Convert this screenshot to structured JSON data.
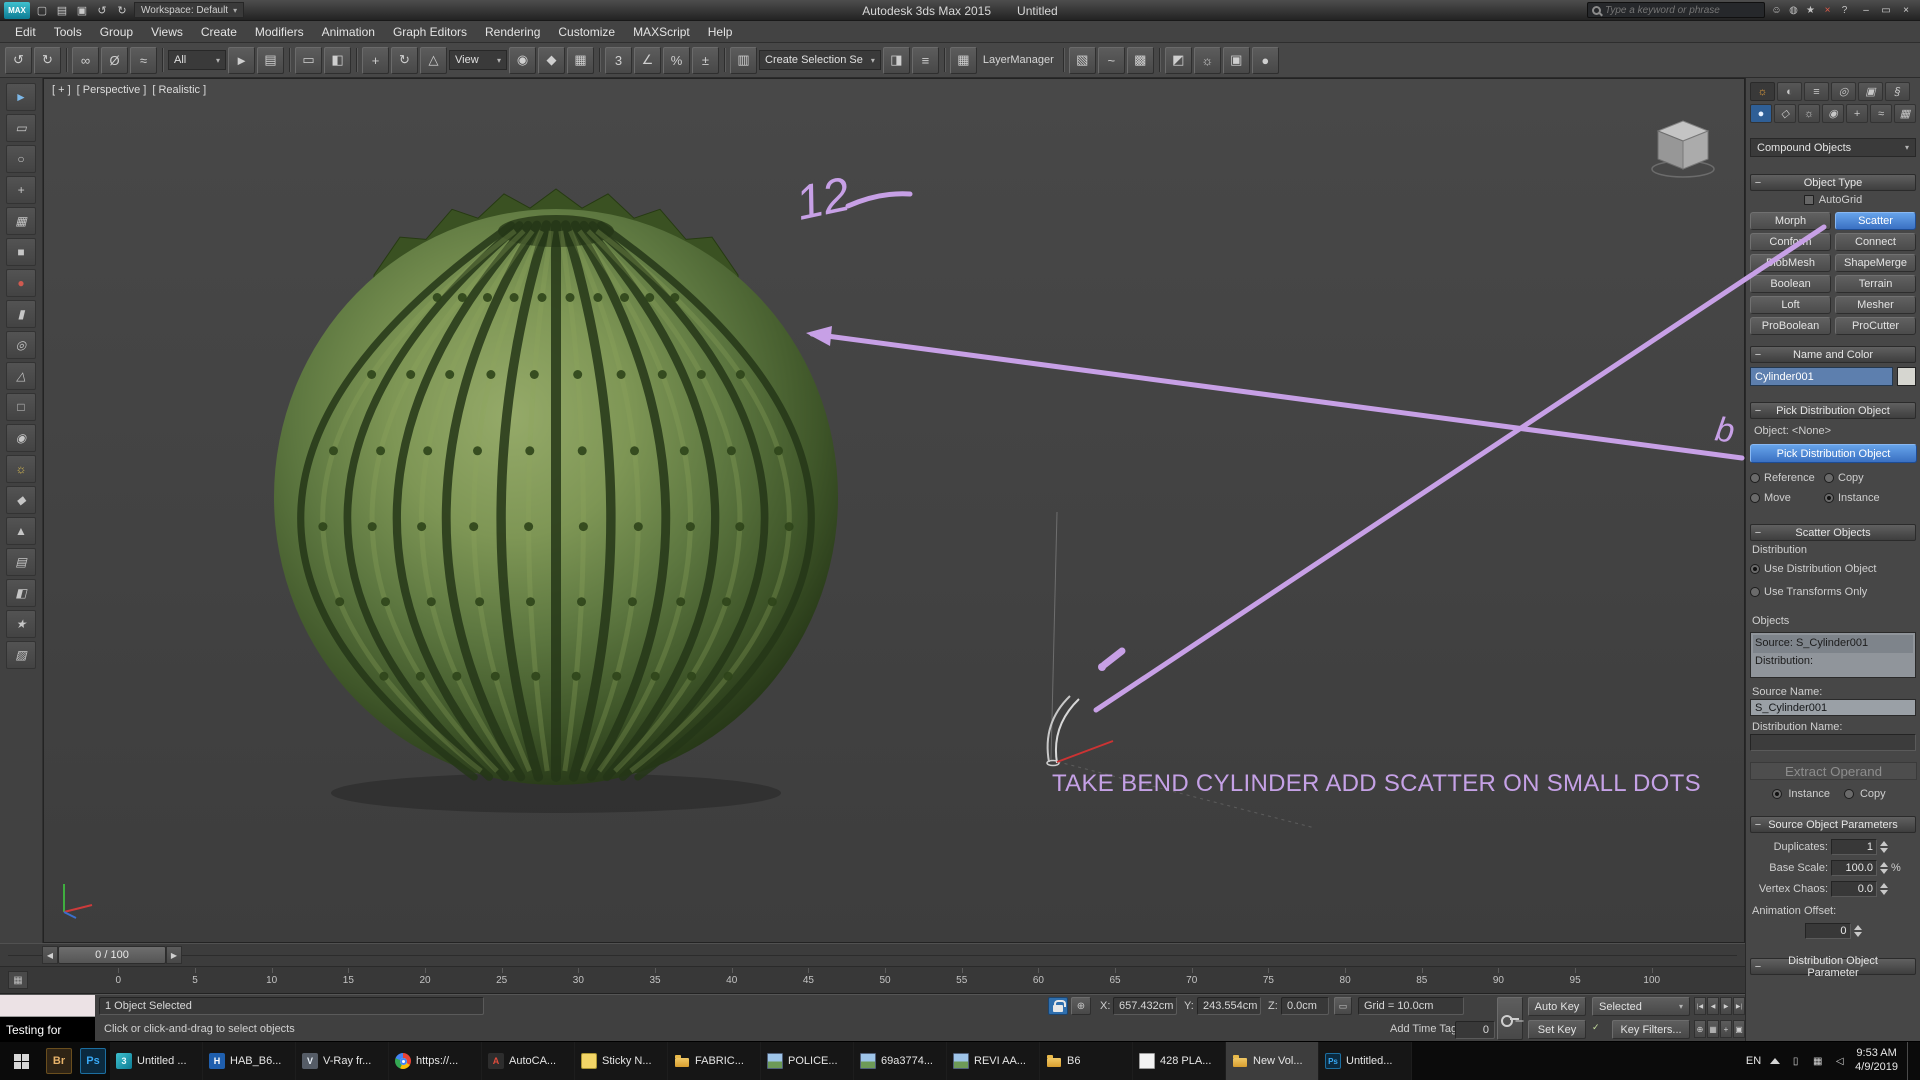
{
  "colors": {
    "annotation_purple": "#c7a0e6",
    "selection_blue": "#3d7cd0",
    "viewport_bg": "#424242"
  },
  "titlebar": {
    "logo_text": "MAX",
    "app_title": "Autodesk 3ds Max 2015",
    "doc_title": "Untitled",
    "workspace_label": "Workspace: Default",
    "search_placeholder": "Type a keyword or phrase",
    "qa_icons": [
      {
        "name": "new-scene-icon",
        "glyph": "▢"
      },
      {
        "name": "open-file-icon",
        "glyph": "▤"
      },
      {
        "name": "save-file-icon",
        "glyph": "▣"
      },
      {
        "name": "undo-icon",
        "glyph": "↺"
      },
      {
        "name": "redo-icon",
        "glyph": "↻"
      }
    ],
    "info_icons": [
      {
        "name": "sign-in-icon",
        "glyph": "☺"
      },
      {
        "name": "communication-center-icon",
        "glyph": "◍"
      },
      {
        "name": "favorites-icon",
        "glyph": "★"
      },
      {
        "name": "close-search-icon",
        "glyph": "×",
        "tone": "red"
      },
      {
        "name": "help-icon",
        "glyph": "?"
      }
    ],
    "window_icons": [
      {
        "name": "minimize-icon",
        "glyph": "–"
      },
      {
        "name": "restore-icon",
        "glyph": "▭"
      },
      {
        "name": "close-icon",
        "glyph": "×"
      }
    ]
  },
  "menubar": {
    "items": [
      "Edit",
      "Tools",
      "Group",
      "Views",
      "Create",
      "Modifiers",
      "Animation",
      "Graph Editors",
      "Rendering",
      "Customize",
      "MAXScript",
      "Help"
    ]
  },
  "toolbar": {
    "items": [
      {
        "type": "icon",
        "name": "undo-icon",
        "glyph": "↺",
        "act": "true"
      },
      {
        "type": "icon",
        "name": "redo-icon",
        "glyph": "↻",
        "act": "true"
      },
      {
        "type": "sep",
        "name": "toolbar-separator",
        "act": "false"
      },
      {
        "type": "icon",
        "name": "select-and-link-icon",
        "glyph": "∞",
        "act": "true"
      },
      {
        "type": "icon",
        "name": "unlink-selection-icon",
        "glyph": "Ø",
        "act": "true"
      },
      {
        "type": "icon",
        "name": "bind-to-space-warp-icon",
        "glyph": "≈",
        "act": "true"
      },
      {
        "type": "sep",
        "name": "toolbar-separator",
        "act": "false"
      },
      {
        "type": "drop",
        "name": "selection-filter-dropdown",
        "label": "All",
        "act": "true"
      },
      {
        "type": "icon",
        "name": "select-object-icon",
        "glyph": "►",
        "act": "true"
      },
      {
        "type": "icon",
        "name": "select-by-name-icon",
        "glyph": "▤",
        "act": "true"
      },
      {
        "type": "sep",
        "name": "toolbar-separator",
        "act": "false"
      },
      {
        "type": "icon",
        "name": "rectangular-selection-icon",
        "glyph": "▭",
        "act": "true"
      },
      {
        "type": "icon",
        "name": "window-crossing-icon",
        "glyph": "◧",
        "act": "true"
      },
      {
        "type": "sep",
        "name": "toolbar-separator",
        "act": "false"
      },
      {
        "type": "icon",
        "name": "select-and-move-icon",
        "glyph": "+",
        "act": "true"
      },
      {
        "type": "icon",
        "name": "select-and-rotate-icon",
        "glyph": "↻",
        "act": "true"
      },
      {
        "type": "icon",
        "name": "select-and-scale-icon",
        "glyph": "△",
        "act": "true"
      },
      {
        "type": "drop",
        "name": "reference-coordinate-dropdown",
        "label": "View",
        "act": "true"
      },
      {
        "type": "icon",
        "name": "use-pivot-center-icon",
        "glyph": "◉",
        "act": "true"
      },
      {
        "type": "icon",
        "name": "select-and-manipulate-icon",
        "glyph": "◆",
        "act": "true"
      },
      {
        "type": "icon",
        "name": "keyboard-override-icon",
        "glyph": "▦",
        "act": "true"
      },
      {
        "type": "sep",
        "name": "toolbar-separator",
        "act": "false"
      },
      {
        "type": "icon",
        "name": "snap-toggle-3d-icon",
        "glyph": "3",
        "act": "true"
      },
      {
        "type": "icon",
        "name": "angle-snap-icon",
        "glyph": "∠",
        "act": "true"
      },
      {
        "type": "icon",
        "name": "percent-snap-icon",
        "glyph": "%",
        "act": "true"
      },
      {
        "type": "icon",
        "name": "spinner-snap-icon",
        "glyph": "±",
        "act": "true"
      },
      {
        "type": "sep",
        "name": "toolbar-separator",
        "act": "false"
      },
      {
        "type": "icon",
        "name": "named-selection-sets-icon",
        "glyph": "▥",
        "act": "true"
      },
      {
        "type": "drop",
        "name": "named-selection-dropdown",
        "label": "Create Selection Se",
        "act": "true"
      },
      {
        "type": "icon",
        "name": "mirror-icon",
        "glyph": "◨",
        "act": "true"
      },
      {
        "type": "icon",
        "name": "align-icon",
        "glyph": "≡",
        "act": "true"
      },
      {
        "type": "sep",
        "name": "toolbar-separator",
        "act": "false"
      },
      {
        "type": "icon",
        "name": "layer-manager-icon",
        "glyph": "▦",
        "act": "true"
      },
      {
        "type": "label",
        "name": "layer-manager-label",
        "label": "LayerManager",
        "act": "false"
      },
      {
        "type": "sep",
        "name": "toolbar-separator",
        "act": "false"
      },
      {
        "type": "icon",
        "name": "graphite-ribbon-icon",
        "glyph": "▧",
        "act": "true"
      },
      {
        "type": "icon",
        "name": "curve-editor-icon",
        "glyph": "~",
        "act": "true"
      },
      {
        "type": "icon",
        "name": "schematic-view-icon",
        "glyph": "▩",
        "act": "true"
      },
      {
        "type": "sep",
        "name": "toolbar-separator",
        "act": "false"
      },
      {
        "type": "icon",
        "name": "material-editor-icon",
        "glyph": "◩",
        "act": "true"
      },
      {
        "type": "icon",
        "name": "render-setup-icon",
        "glyph": "☼",
        "act": "true"
      },
      {
        "type": "icon",
        "name": "rendered-frame-icon",
        "glyph": "▣",
        "act": "true"
      },
      {
        "type": "icon",
        "name": "render-production-icon",
        "glyph": "●",
        "act": "true"
      }
    ]
  },
  "left_strip": {
    "icons": [
      {
        "name": "select-cursor-icon",
        "glyph": "►",
        "tone": "blue"
      },
      {
        "name": "marquee-select-icon",
        "glyph": "▭"
      },
      {
        "name": "circle-select-icon",
        "glyph": "○"
      },
      {
        "name": "paint-select-icon",
        "glyph": "+"
      },
      {
        "name": "grid-helper-icon",
        "glyph": "▦"
      },
      {
        "name": "box-primitive-icon",
        "glyph": "■"
      },
      {
        "name": "sphere-primitive-icon",
        "glyph": "●",
        "tone": "red"
      },
      {
        "name": "cylinder-primitive-icon",
        "glyph": "▮"
      },
      {
        "name": "torus-primitive-icon",
        "glyph": "◎"
      },
      {
        "name": "cone-primitive-icon",
        "glyph": "△"
      },
      {
        "name": "plane-primitive-icon",
        "glyph": "□"
      },
      {
        "name": "geosphere-primitive-icon",
        "glyph": "◉"
      },
      {
        "name": "light-icon",
        "glyph": "☼",
        "tone": "yellow"
      },
      {
        "name": "gem-icon",
        "glyph": "◆"
      },
      {
        "name": "pyramid-primitive-icon",
        "glyph": "▲"
      },
      {
        "name": "list-view-icon",
        "glyph": "▤"
      },
      {
        "name": "half-shade-icon",
        "glyph": "◧"
      },
      {
        "name": "star-shape-icon",
        "glyph": "★"
      },
      {
        "name": "hatch-icon",
        "glyph": "▨"
      }
    ]
  },
  "viewport": {
    "label_plus": "[ + ]",
    "label_view": "[ Perspective ]",
    "label_shading": "[ Realistic ]",
    "annotation_text": "TAKE BEND CYLINDER ADD SCATTER ON SMALL DOTS",
    "scribble_12": "12",
    "scribble_b": "b"
  },
  "command_panel": {
    "tabs": [
      {
        "name": "create-tab-icon",
        "glyph": "☼",
        "state": "active orange"
      },
      {
        "name": "modify-tab-icon",
        "glyph": "◐"
      },
      {
        "name": "hierarchy-tab-icon",
        "glyph": "≡"
      },
      {
        "name": "motion-tab-icon",
        "glyph": "◎"
      },
      {
        "name": "display-tab-icon",
        "glyph": "▣"
      },
      {
        "name": "utilities-tab-icon",
        "glyph": "§"
      }
    ],
    "categories": [
      {
        "name": "geometry-category-icon",
        "glyph": "●",
        "state": "blue"
      },
      {
        "name": "shapes-category-icon",
        "glyph": "◇"
      },
      {
        "name": "lights-category-icon",
        "glyph": "☼"
      },
      {
        "name": "cameras-category-icon",
        "glyph": "◉"
      },
      {
        "name": "helpers-category-icon",
        "glyph": "+"
      },
      {
        "name": "space-warps-category-icon",
        "glyph": "≈"
      },
      {
        "name": "systems-category-icon",
        "glyph": "▦"
      }
    ],
    "category_dropdown": "Compound Objects",
    "object_type": {
      "title": "Object Type",
      "autogrid_label": "AutoGrid",
      "buttons": [
        {
          "label": "Morph"
        },
        {
          "label": "Scatter",
          "state": "active"
        },
        {
          "label": "Conform"
        },
        {
          "label": "Connect"
        },
        {
          "label": "BlobMesh"
        },
        {
          "label": "ShapeMerge"
        },
        {
          "label": "Boolean"
        },
        {
          "label": "Terrain"
        },
        {
          "label": "Loft"
        },
        {
          "label": "Mesher"
        },
        {
          "label": "ProBoolean"
        },
        {
          "label": "ProCutter"
        }
      ]
    },
    "name_color": {
      "title": "Name and Color",
      "object_name": "Cylinder001"
    },
    "pick_distribution": {
      "title": "Pick Distribution Object",
      "object_label": "Object: <None>",
      "button_label": "Pick Distribution Object",
      "reference": "Reference",
      "copy": "Copy",
      "move": "Move",
      "instance": "Instance"
    },
    "scatter_objects": {
      "title": "Scatter Objects",
      "dist_label": "Distribution",
      "use_dist": "Use Distribution Object",
      "use_transforms": "Use Transforms Only",
      "objects_label": "Objects",
      "list_line1": "Source: S_Cylinder001",
      "list_line2": "Distribution:",
      "source_name_label": "Source Name:",
      "source_name_value": "S_Cylinder001",
      "dist_name_label": "Distribution Name:",
      "dist_name_value": "",
      "extract_label": "Extract Operand",
      "instance": "Instance",
      "copy": "Copy"
    },
    "source_params": {
      "title": "Source Object Parameters",
      "duplicates_label": "Duplicates:",
      "duplicates_value": "1",
      "base_scale_label": "Base Scale:",
      "base_scale_value": "100.0",
      "percent_label": "%",
      "vertex_chaos_label": "Vertex Chaos:",
      "vertex_chaos_value": "0.0",
      "anim_offset_label": "Animation Offset:",
      "anim_offset_value": "0"
    },
    "dist_params_title": "Distribution Object Parameter"
  },
  "timeline": {
    "slider_label": "0 / 100",
    "prev_glyph": "◀",
    "next_glyph": "▶",
    "ticks": [
      "0",
      "5",
      "10",
      "15",
      "20",
      "25",
      "30",
      "35",
      "40",
      "45",
      "50",
      "55",
      "60",
      "65",
      "70",
      "75",
      "80",
      "85",
      "90",
      "95",
      "100"
    ]
  },
  "statusbar": {
    "listener_text": "Testing for",
    "selected": "1 Object Selected",
    "prompt": "Click or click-and-drag to select objects",
    "x_label": "X:",
    "x_value": "657.432cm",
    "y_label": "Y:",
    "y_value": "243.554cm",
    "z_label": "Z:",
    "z_value": "0.0cm",
    "grid_label": "Grid = 10.0cm",
    "add_time_tag": "Add Time Tag",
    "frame_value": "0",
    "auto_key": "Auto Key",
    "set_key": "Set Key",
    "selected_dropdown": "Selected",
    "key_filters": "Key Filters...",
    "check_glyph": "✓",
    "aux_glyph": "⊕",
    "abs_glyph": "▭",
    "playback": [
      {
        "name": "go-to-start-icon",
        "glyph": "|◀"
      },
      {
        "name": "previous-frame-icon",
        "glyph": "◀"
      },
      {
        "name": "play-icon",
        "glyph": "▶"
      },
      {
        "name": "go-to-end-icon",
        "glyph": "▶|"
      }
    ],
    "nav": [
      {
        "name": "zoom-icon",
        "glyph": "⊕"
      },
      {
        "name": "zoom-extents-icon",
        "glyph": "▦"
      },
      {
        "name": "pan-icon",
        "glyph": "+"
      },
      {
        "name": "maximize-viewport-icon",
        "glyph": "▣"
      }
    ]
  },
  "taskbar": {
    "pins": [
      {
        "icon": "bridge",
        "glyph": "Br",
        "name": "bridge-icon"
      },
      {
        "icon": "photoshop",
        "glyph": "Ps",
        "name": "photoshop-icon"
      }
    ],
    "items": [
      {
        "label": "Untitled ...",
        "icon": "max",
        "name": "3dsmax-task",
        "glyph": "3"
      },
      {
        "label": "HAB_B6...",
        "icon": "hab",
        "name": "hab-file-task",
        "glyph": "H"
      },
      {
        "label": "V-Ray fr...",
        "icon": "vray",
        "name": "vray-task",
        "glyph": "V"
      },
      {
        "label": "https://...",
        "icon": "chrome",
        "name": "chrome-task",
        "glyph": ""
      },
      {
        "label": "AutoCA...",
        "icon": "acad",
        "name": "autocad-task",
        "glyph": "A"
      },
      {
        "label": "Sticky N...",
        "icon": "sticky",
        "name": "sticky-notes-task",
        "glyph": ""
      },
      {
        "label": "FABRIC...",
        "icon": "folder",
        "name": "folder-task",
        "glyph": ""
      },
      {
        "label": "POLICE...",
        "icon": "image",
        "name": "image-task",
        "glyph": ""
      },
      {
        "label": "69a3774...",
        "icon": "image",
        "name": "image-task",
        "glyph": ""
      },
      {
        "label": "REVI AA...",
        "icon": "image",
        "name": "image-task",
        "glyph": ""
      },
      {
        "label": "B6",
        "icon": "folder",
        "name": "folder-task",
        "glyph": ""
      },
      {
        "label": "428 PLA...",
        "icon": "doc",
        "name": "document-task",
        "glyph": ""
      },
      {
        "label": "New Vol...",
        "icon": "folder",
        "name": "folder-task",
        "glyph": "",
        "state": "active"
      },
      {
        "label": "Untitled...",
        "icon": "ps",
        "name": "photoshop-doc-task",
        "glyph": "Ps"
      }
    ],
    "lang": "EN",
    "time": "9:53 AM",
    "date": "4/9/2019"
  }
}
